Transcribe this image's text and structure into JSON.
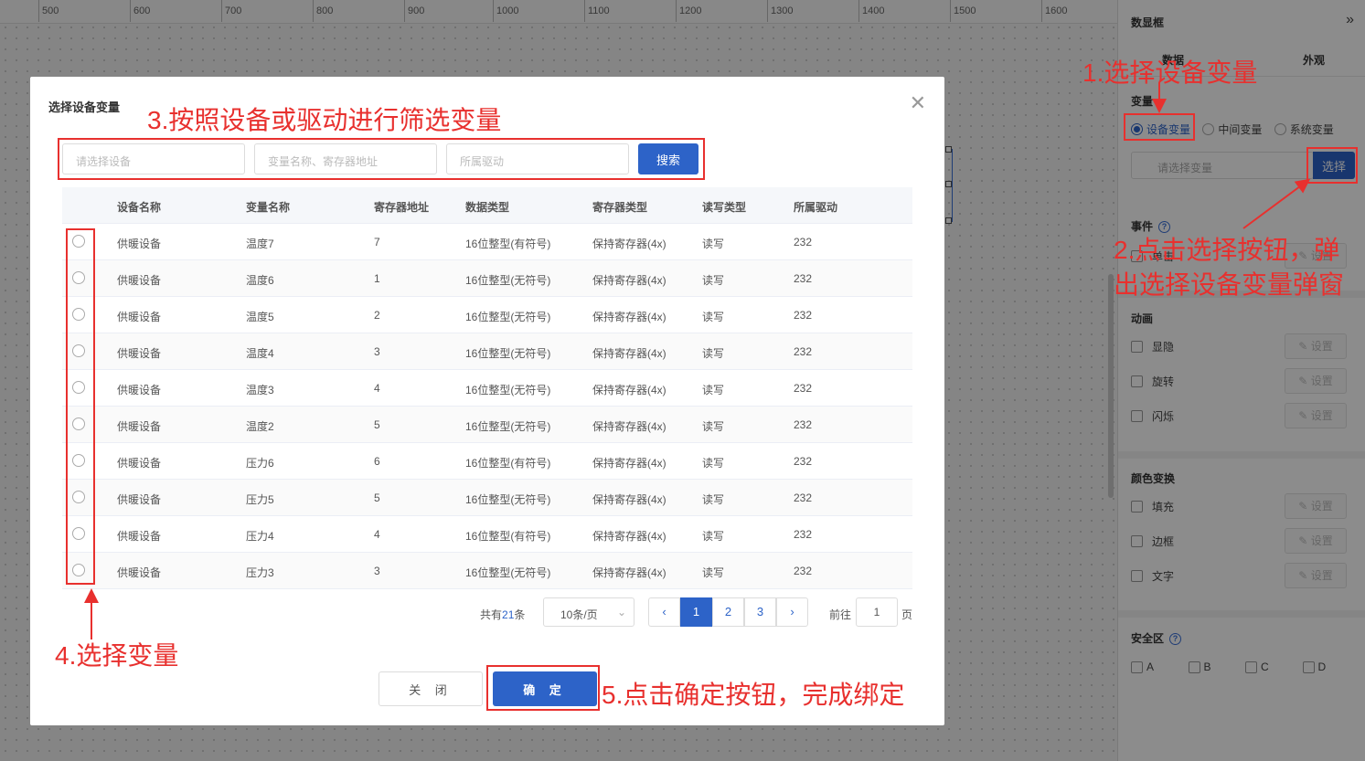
{
  "ruler": {
    "ticks": [
      "500",
      "600",
      "700",
      "800",
      "900",
      "1000",
      "1100",
      "1200",
      "1300",
      "1400",
      "1500",
      "1600"
    ]
  },
  "panel": {
    "title": "数显框",
    "tabs": [
      "数据",
      "外观"
    ],
    "variable_section": "变量",
    "radios": [
      "设备变量",
      "中间变量",
      "系统变量"
    ],
    "var_placeholder": "请选择变量",
    "choose_label": "选择",
    "event_section": "事件",
    "event_items": [
      "单击"
    ],
    "animation_section": "动画",
    "animation_items": [
      "显隐",
      "旋转",
      "闪烁"
    ],
    "color_section": "颜色变换",
    "color_items": [
      "填充",
      "边框",
      "文字"
    ],
    "set_label": "设置",
    "safe_section": "安全区",
    "safe_items": [
      "A",
      "B",
      "C",
      "D"
    ]
  },
  "dialog": {
    "title": "选择设备变量",
    "filters": {
      "device_placeholder": "请选择设备",
      "var_placeholder": "变量名称、寄存器地址",
      "driver_placeholder": "所属驱动",
      "search_label": "搜索"
    },
    "columns": [
      "设备名称",
      "变量名称",
      "寄存器地址",
      "数据类型",
      "寄存器类型",
      "读写类型",
      "所属驱动"
    ],
    "rows": [
      [
        "供暖设备",
        "温度7",
        "7",
        "16位整型(有符号)",
        "保持寄存器(4x)",
        "读写",
        "232"
      ],
      [
        "供暖设备",
        "温度6",
        "1",
        "16位整型(无符号)",
        "保持寄存器(4x)",
        "读写",
        "232"
      ],
      [
        "供暖设备",
        "温度5",
        "2",
        "16位整型(无符号)",
        "保持寄存器(4x)",
        "读写",
        "232"
      ],
      [
        "供暖设备",
        "温度4",
        "3",
        "16位整型(无符号)",
        "保持寄存器(4x)",
        "读写",
        "232"
      ],
      [
        "供暖设备",
        "温度3",
        "4",
        "16位整型(无符号)",
        "保持寄存器(4x)",
        "读写",
        "232"
      ],
      [
        "供暖设备",
        "温度2",
        "5",
        "16位整型(无符号)",
        "保持寄存器(4x)",
        "读写",
        "232"
      ],
      [
        "供暖设备",
        "压力6",
        "6",
        "16位整型(有符号)",
        "保持寄存器(4x)",
        "读写",
        "232"
      ],
      [
        "供暖设备",
        "压力5",
        "5",
        "16位整型(无符号)",
        "保持寄存器(4x)",
        "读写",
        "232"
      ],
      [
        "供暖设备",
        "压力4",
        "4",
        "16位整型(有符号)",
        "保持寄存器(4x)",
        "读写",
        "232"
      ],
      [
        "供暖设备",
        "压力3",
        "3",
        "16位整型(无符号)",
        "保持寄存器(4x)",
        "读写",
        "232"
      ]
    ],
    "pagination": {
      "total_prefix": "共有",
      "total": "21",
      "total_suffix": "条",
      "page_size": "10条/页",
      "pages": [
        "1",
        "2",
        "3"
      ],
      "current_page": "1",
      "goto_label": "前往",
      "goto_value": "1",
      "page_unit": "页"
    },
    "close_label": "关 闭",
    "ok_label": "确 定"
  },
  "annotations": {
    "step1": "1.选择设备变量",
    "step2_line1": "2.点击选择按钮，弹",
    "step2_line2": "出选择设备变量弹窗",
    "step3": "3.按照设备或驱动进行筛选变量",
    "step4": "4.选择变量",
    "step5": "5.点击确定按钮，完成绑定",
    "color": "#e8302e"
  },
  "colors": {
    "primary": "#2d63c8"
  }
}
